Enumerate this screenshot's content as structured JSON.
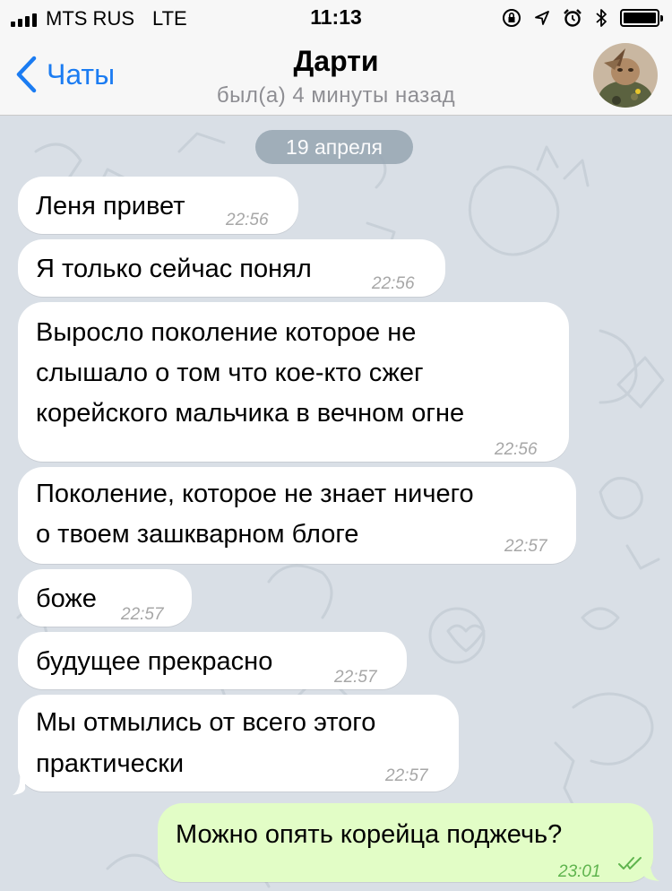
{
  "status_bar": {
    "carrier": "MTS RUS",
    "network": "LTE",
    "time": "11:13"
  },
  "nav": {
    "back_label": "Чаты",
    "title": "Дарти",
    "subtitle": "был(а) 4 минуты назад"
  },
  "chat": {
    "date_label": "19 апреля",
    "messages": [
      {
        "text": "Леня привет",
        "time": "22:56",
        "direction": "in"
      },
      {
        "text": "Я только сейчас понял",
        "time": "22:56",
        "direction": "in"
      },
      {
        "text": "Выросло поколение которое не\nслышало о том что кое-кто сжег\nкорейского мальчика в вечном огне",
        "time": "22:56",
        "direction": "in"
      },
      {
        "text": "Поколение, которое не знает ничего\nо твоем зашкварном блоге",
        "time": "22:57",
        "direction": "in"
      },
      {
        "text": "боже",
        "time": "22:57",
        "direction": "in"
      },
      {
        "text": "будущее прекрасно",
        "time": "22:57",
        "direction": "in"
      },
      {
        "text": "Мы отмылись от всего этого\nпрактически",
        "time": "22:57",
        "direction": "in"
      },
      {
        "text": "Можно опять корейца поджечь?",
        "time": "23:01",
        "direction": "out"
      }
    ]
  },
  "colors": {
    "accent": "#1b7cf2",
    "chat_background": "#d9dfe6",
    "incoming_bubble": "#ffffff",
    "outgoing_bubble": "#e2fdc6",
    "outgoing_time": "#5fb44e"
  }
}
